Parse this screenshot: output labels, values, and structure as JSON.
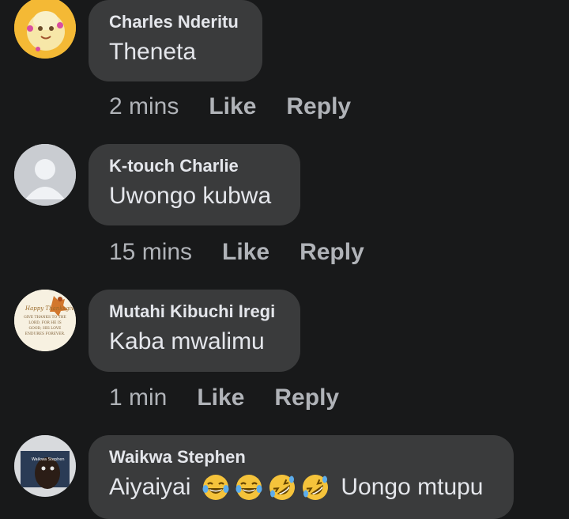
{
  "comments": [
    {
      "author": "Charles Nderitu",
      "text": "Theneta",
      "time": "2 mins",
      "like": "Like",
      "reply": "Reply"
    },
    {
      "author": "K-touch Charlie",
      "text": "Uwongo kubwa",
      "time": "15 mins",
      "like": "Like",
      "reply": "Reply"
    },
    {
      "author": "Mutahi Kibuchi Iregi",
      "text": "Kaba mwalimu",
      "time": "1 min",
      "like": "Like",
      "reply": "Reply",
      "avatar_lines": [
        "Happy Thanksgiving",
        "GIVE THANKS TO THE",
        "LORD, FOR HE IS",
        "GOOD; HIS LOVE",
        "ENDURES FOREVER."
      ]
    },
    {
      "author": "Waikwa Stephen",
      "text_before": "Aiyaiyai",
      "text_after": "Uongo mtupu",
      "emojis": [
        "tears-of-joy-emoji",
        "tears-of-joy-emoji",
        "rolling-laughing-emoji",
        "rolling-laughing-emoji"
      ],
      "avatar_caption": "Waikwa Stephen"
    }
  ],
  "colors": {
    "background": "#18191a",
    "bubble": "#3a3b3c",
    "text": "#e4e6eb",
    "meta": "#b0b3b8"
  }
}
